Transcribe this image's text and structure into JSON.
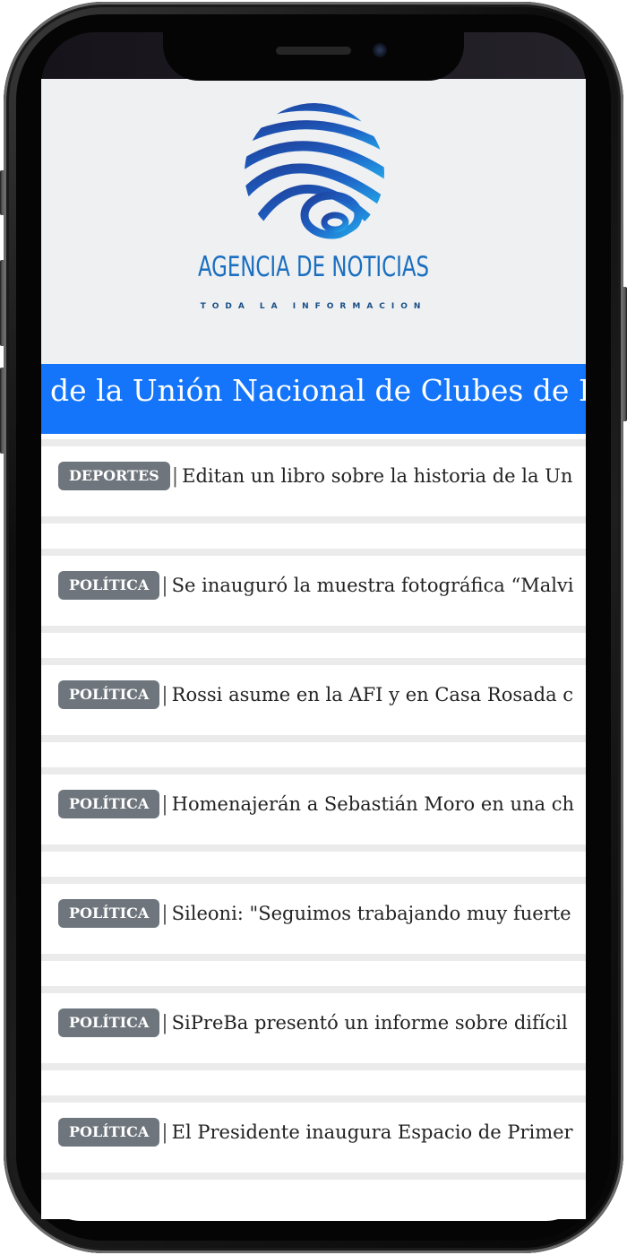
{
  "header": {
    "brand_name": "AGENCIA DE NOTICIAS",
    "tagline": "TODA LA INFORMACION",
    "logo_icon": "globe-stripes-icon",
    "brand_color": "#1a6fc0"
  },
  "ticker": {
    "text": "de la Unión Nacional de Clubes de B",
    "background": "#1475fa"
  },
  "news": [
    {
      "category": "DEPORTES",
      "separator": "|",
      "title": "Editan un libro sobre la historia de la Un"
    },
    {
      "category": "POLÍTICA",
      "separator": "|",
      "title": "Se inauguró la muestra fotográfica “Malvi"
    },
    {
      "category": "POLÍTICA",
      "separator": "|",
      "title": "Rossi asume en la AFI y en Casa Rosada c"
    },
    {
      "category": "POLÍTICA",
      "separator": "|",
      "title": "Homenajerán a Sebastián Moro en una ch"
    },
    {
      "category": "POLÍTICA",
      "separator": "|",
      "title": "Sileoni: \"Seguimos trabajando muy fuerte"
    },
    {
      "category": "POLÍTICA",
      "separator": "|",
      "title": "SiPreBa presentó un informe sobre difícil"
    },
    {
      "category": "POLÍTICA",
      "separator": "|",
      "title": "El Presidente inaugura Espacio de Primer"
    }
  ],
  "colors": {
    "badge_bg": "#6e757c",
    "separator_bg": "#ebebeb"
  }
}
